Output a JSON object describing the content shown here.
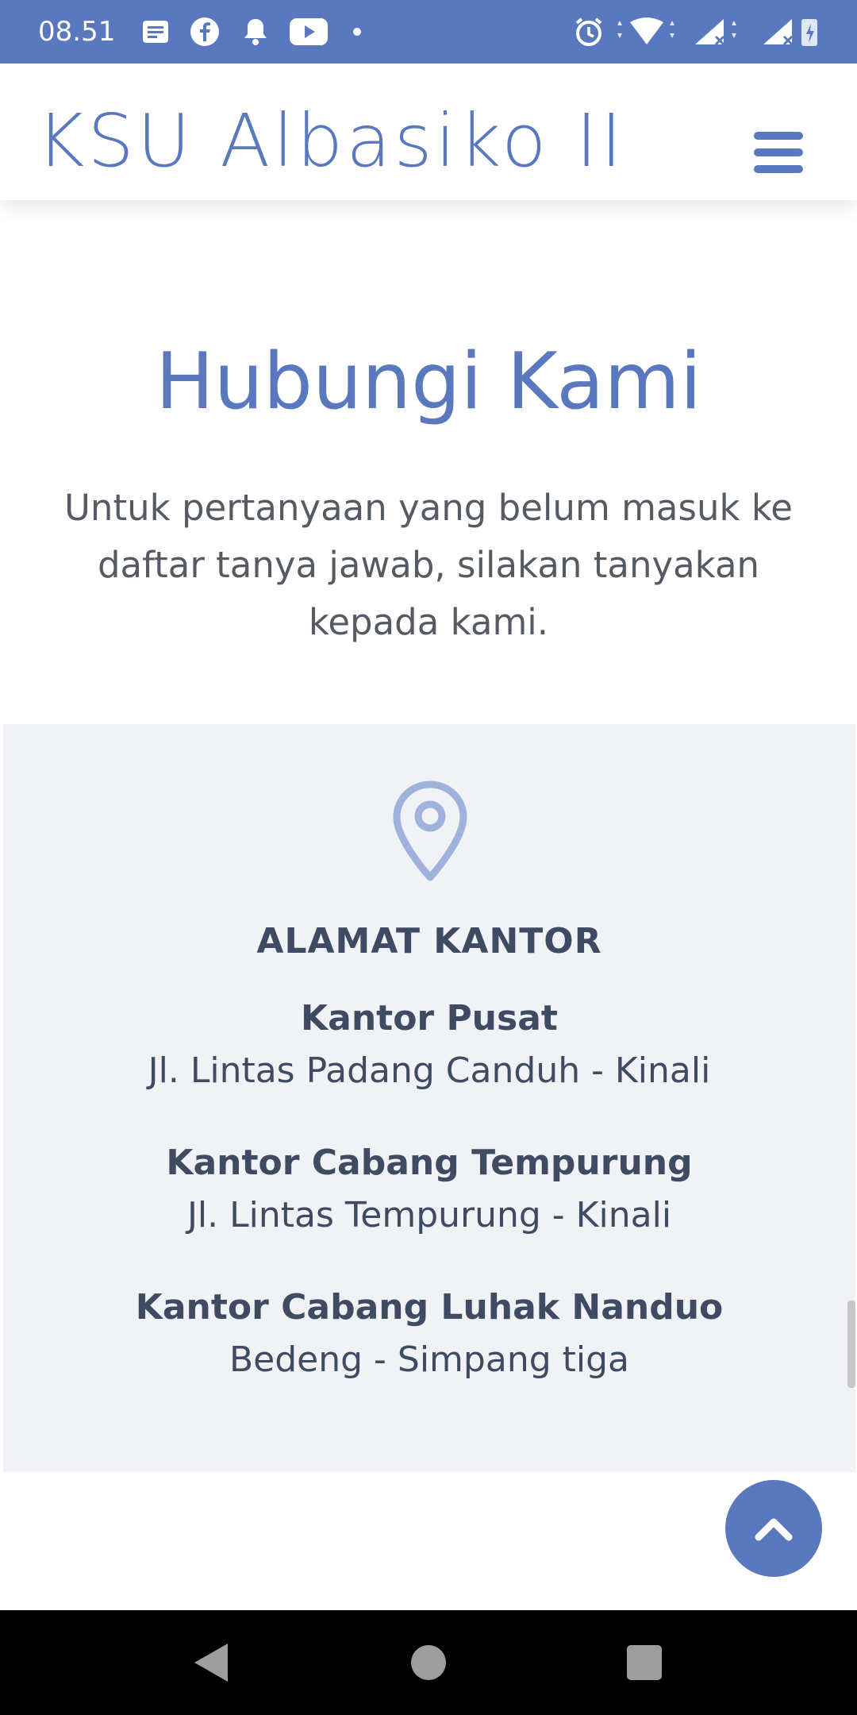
{
  "status_bar": {
    "time": "08.51",
    "icons_left": [
      "notes-icon",
      "facebook-icon",
      "bell-icon",
      "youtube-icon",
      "dot-icon"
    ],
    "icons_right": [
      "alarm-icon",
      "wifi-icon",
      "signal-icon",
      "signal-icon",
      "battery-icon"
    ]
  },
  "header": {
    "brand": "KSU Albasiko II",
    "menu_icon": "hamburger-menu-icon"
  },
  "main": {
    "title": "Hubungi Kami",
    "intro": "Untuk pertanyaan yang belum masuk ke daftar tanya jawab, silakan tanyakan kepada kami."
  },
  "address_card": {
    "icon": "location-pin-icon",
    "title": "ALAMAT KANTOR",
    "offices": [
      {
        "name": "Kantor Pusat",
        "address": "Jl. Lintas Padang Canduh - Kinali"
      },
      {
        "name": "Kantor Cabang Tempurung",
        "address": "Jl. Lintas Tempurung - Kinali"
      },
      {
        "name": "Kantor Cabang Luhak Nanduo",
        "address": "Bedeng - Simpang tiga"
      }
    ]
  },
  "back_to_top": {
    "icon": "chevron-up-icon"
  },
  "nav_bar": {
    "icons": [
      "back-icon",
      "home-icon",
      "recents-icon"
    ]
  },
  "colors": {
    "accent": "#5a78bd",
    "pin": "#9fb2dc",
    "text_dark": "#3f4a63",
    "text_body": "#555a63",
    "card_bg": "#f0f2f6"
  }
}
